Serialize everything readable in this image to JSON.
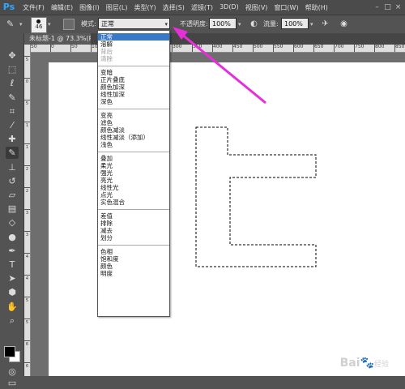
{
  "app": {
    "logo": "Ps"
  },
  "menubar": {
    "items": [
      "文件(F)",
      "编辑(E)",
      "图像(I)",
      "图层(L)",
      "类型(Y)",
      "选择(S)",
      "滤镜(T)",
      "3D(D)",
      "视图(V)",
      "窗口(W)",
      "帮助(H)"
    ],
    "window_controls": [
      "–",
      "□",
      "×"
    ]
  },
  "options": {
    "brush_size": "46",
    "mode_label": "模式:",
    "mode_value": "正常",
    "opacity_label": "不透明度:",
    "opacity_value": "100%",
    "flow_label": "流量:",
    "flow_value": "100%"
  },
  "document": {
    "tab_title": "未标题-1 @ 73.3%(RGB/8)"
  },
  "ruler": {
    "top": [
      "50",
      "0",
      "50",
      "100",
      "150",
      "200",
      "250",
      "300",
      "350",
      "400",
      "450",
      "500",
      "550",
      "600",
      "650",
      "700",
      "750",
      "800",
      "850"
    ],
    "left": [
      "5",
      "0",
      "5",
      "1",
      "1",
      "2",
      "2",
      "3",
      "3",
      "4",
      "4",
      "5",
      "5",
      "6",
      "6"
    ]
  },
  "blend_modes": {
    "groups": [
      {
        "items": [
          {
            "label": "正常",
            "state": "selected"
          },
          {
            "label": "溶解",
            "state": "normal"
          },
          {
            "label": "背后",
            "state": "disabled"
          },
          {
            "label": "清除",
            "state": "disabled"
          }
        ]
      },
      {
        "items": [
          {
            "label": "变暗",
            "state": "normal"
          },
          {
            "label": "正片叠底",
            "state": "normal"
          },
          {
            "label": "颜色加深",
            "state": "normal"
          },
          {
            "label": "线性加深",
            "state": "normal"
          },
          {
            "label": "深色",
            "state": "normal"
          }
        ]
      },
      {
        "items": [
          {
            "label": "变亮",
            "state": "normal"
          },
          {
            "label": "滤色",
            "state": "normal"
          },
          {
            "label": "颜色减淡",
            "state": "normal"
          },
          {
            "label": "线性减淡（添加）",
            "state": "normal"
          },
          {
            "label": "浅色",
            "state": "normal"
          }
        ]
      },
      {
        "items": [
          {
            "label": "叠加",
            "state": "normal"
          },
          {
            "label": "柔光",
            "state": "normal"
          },
          {
            "label": "强光",
            "state": "normal"
          },
          {
            "label": "亮光",
            "state": "normal"
          },
          {
            "label": "线性光",
            "state": "normal"
          },
          {
            "label": "点光",
            "state": "normal"
          },
          {
            "label": "实色混合",
            "state": "normal"
          }
        ]
      },
      {
        "items": [
          {
            "label": "差值",
            "state": "normal"
          },
          {
            "label": "排除",
            "state": "normal"
          },
          {
            "label": "减去",
            "state": "normal"
          },
          {
            "label": "划分",
            "state": "normal"
          }
        ]
      },
      {
        "items": [
          {
            "label": "色相",
            "state": "normal"
          },
          {
            "label": "饱和度",
            "state": "normal"
          },
          {
            "label": "颜色",
            "state": "normal"
          },
          {
            "label": "明度",
            "state": "normal"
          }
        ]
      }
    ]
  },
  "colors": {
    "foreground": "#000000",
    "background": "#ffffff",
    "annotation_arrow": "#e62fd8",
    "selected_item": "#3a78c8"
  },
  "watermark": {
    "main": "Bai",
    "paw": "🐾",
    "sub": "经验"
  }
}
